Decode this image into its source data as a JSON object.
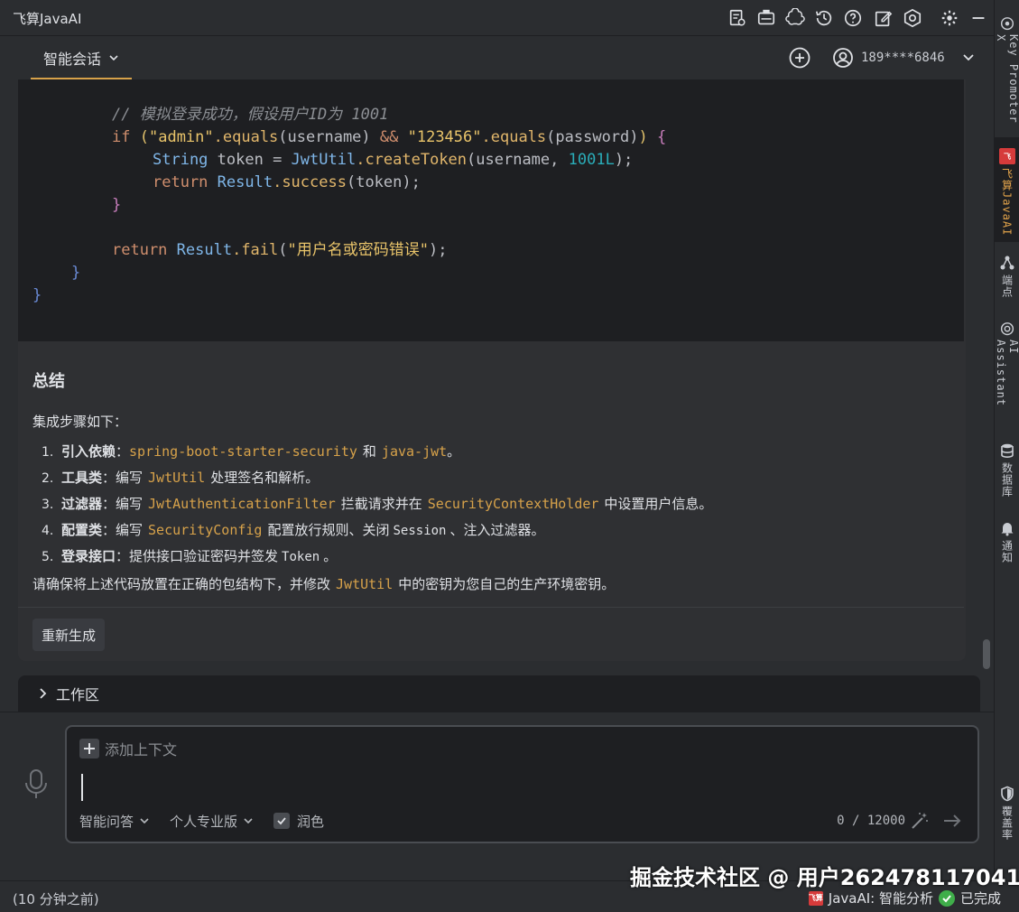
{
  "app": {
    "title": "飞算JavaAI"
  },
  "header": {
    "tab_label": "智能会话",
    "user_phone": "189****6846"
  },
  "code": {
    "line1_comment": "// 模拟登录成功，假设用户ID为 1001",
    "line2": {
      "kw_if": "if",
      "open_paren": "(",
      "str_admin": "\"admin\"",
      "equals1": ".equals",
      "arg_user": "(username)",
      "and": " && ",
      "str_pwd": "\"123456\"",
      "equals2": ".equals",
      "arg_pwd": "(password)",
      "close_paren": ")",
      "brace": " {"
    },
    "line3": {
      "type": "String",
      "rest1": " token = ",
      "cls": "JwtUtil",
      "fn": ".createToken",
      "args_open": "(username, ",
      "num": "1001L",
      "args_close": ");"
    },
    "line4": {
      "kw": "return",
      "cls": " Result",
      "fn": ".success",
      "args": "(token);"
    },
    "line5": "}",
    "line7": {
      "kw": "return",
      "cls": " Result",
      "fn": ".fail",
      "args_open": "(",
      "str": "\"用户名或密码错误\"",
      "args_close": ");"
    },
    "line8": "}",
    "line9": "}"
  },
  "summary": {
    "title": "总结",
    "intro": "集成步骤如下：",
    "steps": [
      {
        "num": "1.",
        "bold": "引入依赖",
        "sep": "：",
        "code1": "spring-boot-starter-security",
        "mid": "和",
        "code2": "java-jwt",
        "end": "。"
      },
      {
        "num": "2.",
        "bold": "工具类",
        "sep": "：编写",
        "code1": "JwtUtil",
        "end": "处理签名和解析。"
      },
      {
        "num": "3.",
        "bold": "过滤器",
        "sep": "：编写",
        "code1": "JwtAuthenticationFilter",
        "mid": "拦截请求并在",
        "code2": "SecurityContextHolder",
        "end": "中设置用户信息。"
      },
      {
        "num": "4.",
        "bold": "配置类",
        "sep": "：编写",
        "code1": "SecurityConfig",
        "mid": "配置放行规则、关闭",
        "plain1": "Session",
        "end": "、注入过滤器。"
      },
      {
        "num": "5.",
        "bold": "登录接口",
        "sep": "：提供接口验证密码并签发",
        "plain1": "Token",
        "end": "。"
      }
    ],
    "outro_pre": "请确保将上述代码放置在正确的包结构下，并修改",
    "outro_code": "JwtUtil",
    "outro_post": "中的密钥为您自己的生产环境密钥。"
  },
  "actions": {
    "regenerate": "重新生成"
  },
  "workspace": {
    "label": "工作区"
  },
  "input": {
    "add_context": "添加上下文",
    "value": "",
    "mode": "智能问答",
    "edition": "个人专业版",
    "polish": "润色",
    "polish_checked": true,
    "char_count": "0 / 12000"
  },
  "rightbar": {
    "items": [
      {
        "label": "Key Promoter X",
        "icon": "key-promoter-icon"
      },
      {
        "label": "飞算JavaAI",
        "icon": "feisuan-logo-icon"
      },
      {
        "label": "端点",
        "icon": "endpoints-icon"
      },
      {
        "label": "AI Assistant",
        "icon": "ai-assistant-icon"
      },
      {
        "label": "数据库",
        "icon": "database-icon"
      },
      {
        "label": "通知",
        "icon": "bell-icon"
      },
      {
        "label": "覆盖率",
        "icon": "shield-icon"
      }
    ]
  },
  "status": {
    "left": "(10 分钟之前)",
    "logo_text": "飞算",
    "task": "JavaAI: 智能分析",
    "done": "已完成"
  },
  "watermark": "掘金技术社区 @ 用户262478117041",
  "colors": {
    "accent": "#d7a24a",
    "editor_bg": "#1e1f22",
    "panel_bg": "#2b2d30",
    "success": "#3fae4a"
  }
}
